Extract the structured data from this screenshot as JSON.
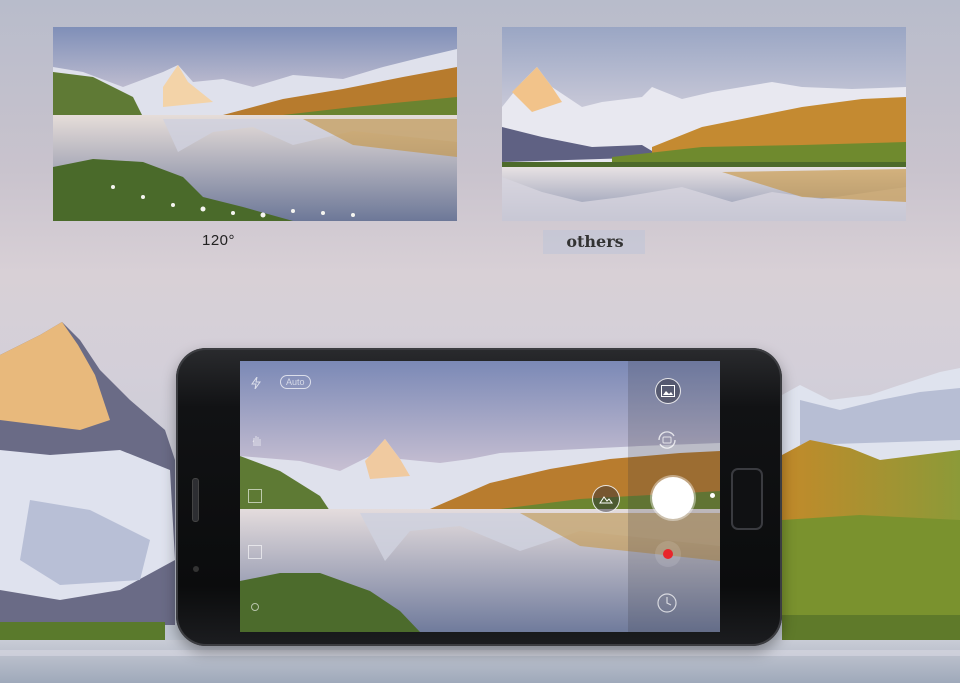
{
  "captions": {
    "left": "120°",
    "right": "others"
  },
  "camera_ui": {
    "mode_badge": "Auto",
    "left_icons": [
      "flash-icon",
      "auto-mode-icon",
      "hand-icon",
      "exposure-icon",
      "hdr-icon",
      "settings-icon"
    ],
    "right_icons": [
      "gallery-icon",
      "switch-camera-icon",
      "landscape-icon",
      "shutter-button",
      "record-icon",
      "timer-icon"
    ]
  },
  "colors": {
    "record": "#e8262b",
    "shutter": "#ffffff",
    "panel_bg": "#3c3c46"
  }
}
